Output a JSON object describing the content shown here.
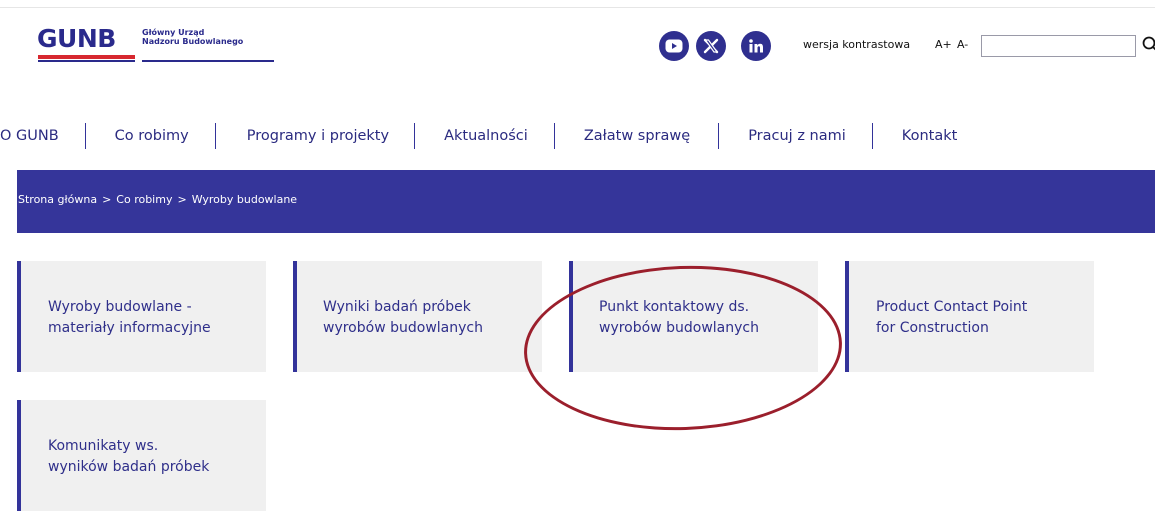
{
  "header": {
    "logo": {
      "mark": "GUNB",
      "line1": "Główny Urząd",
      "line2": "Nadzoru Budowlanego"
    },
    "social": [
      {
        "name": "youtube-icon"
      },
      {
        "name": "x-icon"
      },
      {
        "name": "linkedin-icon"
      }
    ],
    "contrast_label": "wersja kontrastowa",
    "font_increase": "A+",
    "font_decrease": "A-",
    "search": {
      "value": "",
      "placeholder": ""
    }
  },
  "nav": {
    "items": [
      "O GUNB",
      "Co robimy",
      "Programy i projekty",
      "Aktualności",
      "Załatw sprawę",
      "Pracuj z nami",
      "Kontakt"
    ]
  },
  "breadcrumb": {
    "items": [
      "Strona główna",
      "Co robimy",
      "Wyroby budowlane"
    ],
    "separator": ">"
  },
  "tiles": [
    "Wyroby budowlane -\nmateriały informacyjne",
    "Wyniki badań próbek\nwyrobów budowlanych",
    "Punkt kontaktowy ds.\nwyrobów budowlanych",
    "Product Contact Point\nfor Construction",
    "Komunikaty ws.\nwyników badań próbek"
  ],
  "colors": {
    "brand": "#35359a",
    "accent_red": "#d7282f",
    "annotation": "#9b1f2c",
    "tile_bg": "#f0f0f0"
  }
}
